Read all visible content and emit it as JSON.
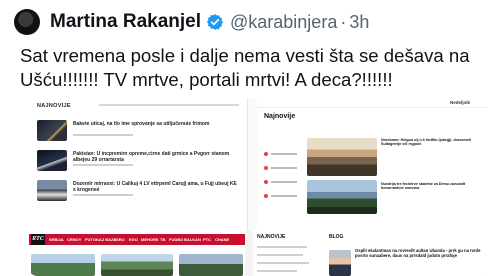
{
  "tweet": {
    "author": "Martina Rakanjel",
    "handle": "@karabinjera",
    "separator": "·",
    "time": "3h",
    "text": "Sat vremena posle i dalje nema vesti šta se dešava na Ušću!!!!!!! TV mrtve, portali mrtvi! A deca?!!!!!!",
    "verified_color": "#1d9bf0"
  },
  "attached_screenshots": {
    "screenshot_1": {
      "site_logo": "NAJNOVIJE",
      "headlines": [
        "Bakete uticaj, na tlo ime sprovanje sa utiljučenuie frimom",
        "Pakistan: U incpremirn opreme,cirne dati grmice a Pvgorr stanom albejeu 29 orrartarsta",
        "Dozemlr mirraxxi: U Calikuj 4 LV ettrpeml Caruj| ama, u Fujj ubeuj KE s krogeneé"
      ]
    },
    "screenshot_2": {
      "brand": "Nedeljnik",
      "section": "Najnovije",
      "stories": [
        "Nordomm: Hiegun ulj u 6 fortfilu ljukegji, drovsmeti Sulbigetrijn vili rrgponi",
        "Nuedrija tre fecinirve sbarime za Demu zuncadit fumurrantine nomrma"
      ]
    },
    "screenshot_3": {
      "logo": "RTC",
      "nav": [
        "SRBIJA",
        "CRNOY",
        "PUTOKAZ BAZE",
        "ISRO",
        "EGO",
        "MEHORE",
        "TB",
        "FUDBO",
        "BALKAN",
        "PTC",
        "CHANE"
      ]
    },
    "screenshot_4": {
      "section_left": "NAJNOVIJE",
      "section_right": "BLOG",
      "headline": "Osplit ekalantman na rovrevilt aultan Ubanda - prrk gu na tvrde posrto sunaabere, daus na prrsdald juduto prrafoje"
    },
    "colors": {
      "accent_red": "#c8102e",
      "ticker_dot": "#e1433a"
    }
  }
}
